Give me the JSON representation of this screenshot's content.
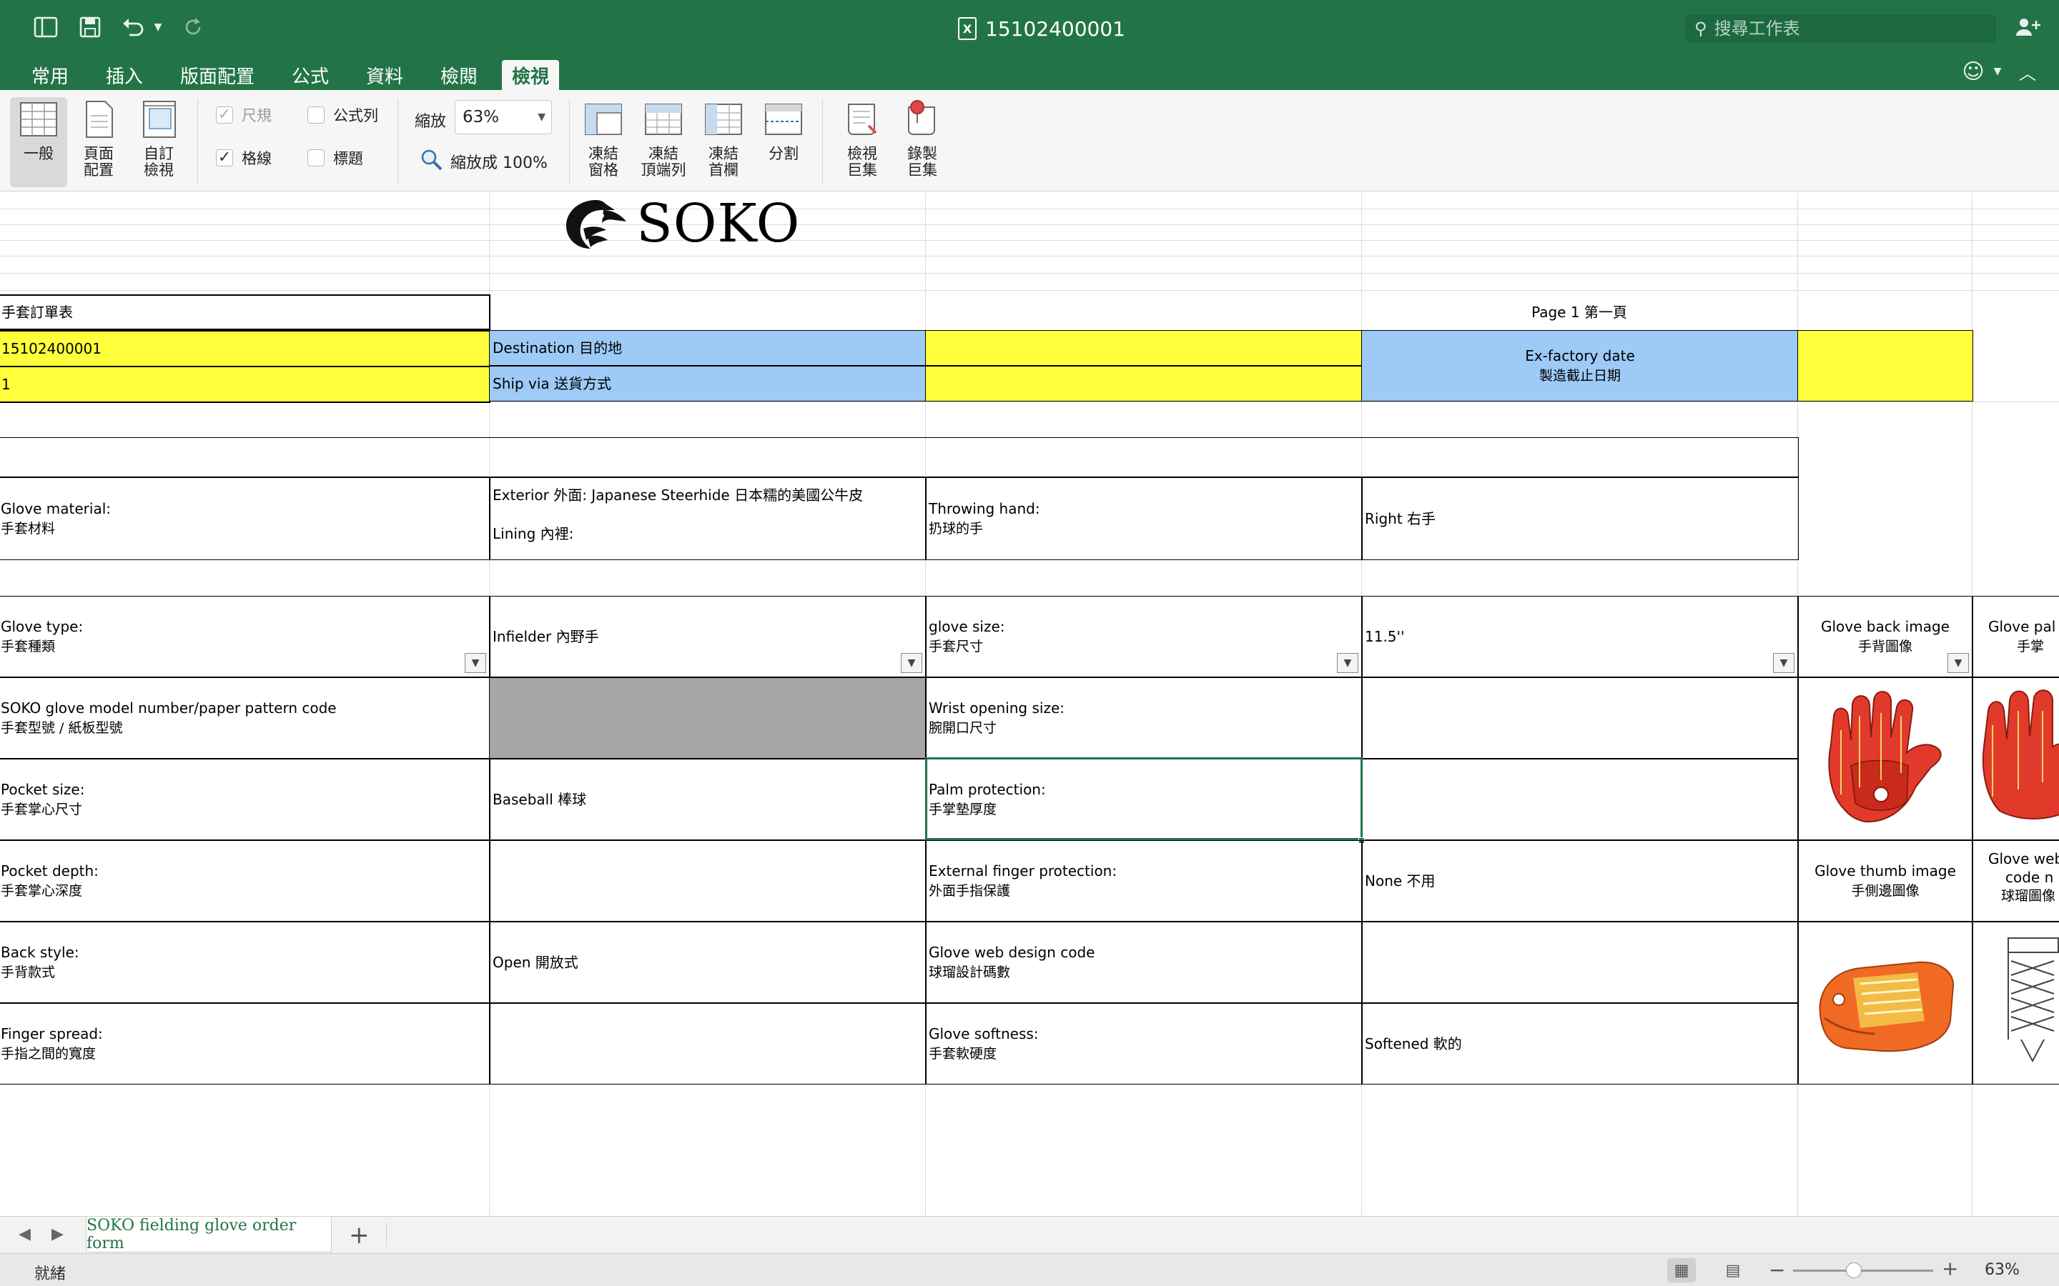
{
  "app": {
    "doc_title": "15102400001",
    "search_placeholder": "搜尋工作表"
  },
  "menu": {
    "tabs": [
      "常用",
      "插入",
      "版面配置",
      "公式",
      "資料",
      "檢閱",
      "檢視"
    ],
    "active_tab": "檢視"
  },
  "ribbon": {
    "view_normal": "一般",
    "view_page_line1": "頁面",
    "view_page_line2": "配置",
    "view_custom_line1": "自訂",
    "view_custom_line2": "檢視",
    "ruler": "尺規",
    "formula_bar": "公式列",
    "gridlines": "格線",
    "headings": "標題",
    "zoom_label": "縮放",
    "zoom_value": "63%",
    "zoom_100": "縮放成 100%",
    "freeze_panes_line1": "凍結",
    "freeze_panes_line2": "窗格",
    "freeze_top_line1": "凍結",
    "freeze_top_line2": "頂端列",
    "freeze_first_line1": "凍結",
    "freeze_first_line2": "首欄",
    "split": "分割",
    "view_macros_line1": "檢視",
    "view_macros_line2": "巨集",
    "record_macro_line1": "錄製",
    "record_macro_line2": "巨集"
  },
  "checkboxes": {
    "ruler": false,
    "formula_bar": false,
    "gridlines": true,
    "headings": false
  },
  "sheet": {
    "logo_text": "SOKO",
    "form_title": "手套訂單表",
    "page_label": "Page 1 第一頁",
    "order_number": "15102400001",
    "quantity": "1",
    "destination": "Destination 目的地",
    "ship_via": "Ship via  送貨方式",
    "exfactory_en": "Ex-factory date",
    "exfactory_zh": "製造截止日期",
    "glove_material_en": "Glove material:",
    "glove_material_zh": "手套材料",
    "exterior": "Exterior 外面:  Japanese Steerhide  日本糯的美國公牛皮",
    "lining": "Lining 內裡:",
    "throwing_hand_en": "Throwing hand:",
    "throwing_hand_zh": "扔球的手",
    "throwing_hand_value": "Right  右手",
    "glove_type_en": "Glove type:",
    "glove_type_zh": "手套種類",
    "glove_type_value": "Infielder  內野手",
    "glove_size_en": "glove size:",
    "glove_size_zh": "手套尺寸",
    "glove_size_value": "11.5''",
    "back_image_en": "Glove back image",
    "back_image_zh": "手背圖像",
    "palm_image_en": "Glove pal",
    "palm_image_zh": "手掌",
    "model_en": "SOKO glove model number/paper pattern code",
    "model_zh": "手套型號 / 紙板型號",
    "wrist_en": "Wrist opening size:",
    "wrist_zh": "腕開口尺寸",
    "pocket_size_en": "Pocket size:",
    "pocket_size_zh": "手套掌心尺寸",
    "pocket_size_value": "Baseball  棒球",
    "palm_protection_en": "Palm protection:",
    "palm_protection_zh": "手掌墊厚度",
    "pocket_depth_en": "Pocket depth:",
    "pocket_depth_zh": "手套掌心深度",
    "ext_finger_en": "External finger protection:",
    "ext_finger_zh": "外面手指保護",
    "ext_finger_value": "None  不用",
    "thumb_image_en": "Glove thumb image",
    "thumb_image_zh": "手側邊圖像",
    "web_code_image_en1": "Glove web",
    "web_code_image_en2": "code n",
    "web_code_image_zh": "球瑠圖像",
    "back_style_en": "Back style:",
    "back_style_zh": "手背款式",
    "back_style_value": "Open  開放式",
    "web_design_en": "Glove web design code",
    "web_design_zh": "球瑠設計碼數",
    "finger_spread_en": "Finger spread:",
    "finger_spread_zh": "手指之間的寬度",
    "softness_en": "Glove softness:",
    "softness_zh": "手套軟硬度",
    "softness_value": "Softened  軟的"
  },
  "sheet_tabs": {
    "active": "SOKO fielding glove order form",
    "add": "+"
  },
  "status": {
    "ready": "就緒",
    "zoom_percent": "63%",
    "zoom_level": 0.63
  },
  "colors": {
    "excel_green": "#227447",
    "cell_yellow": "#ffff3b",
    "cell_blue": "#9dcaf6",
    "cell_gray": "#a6a6a6"
  }
}
